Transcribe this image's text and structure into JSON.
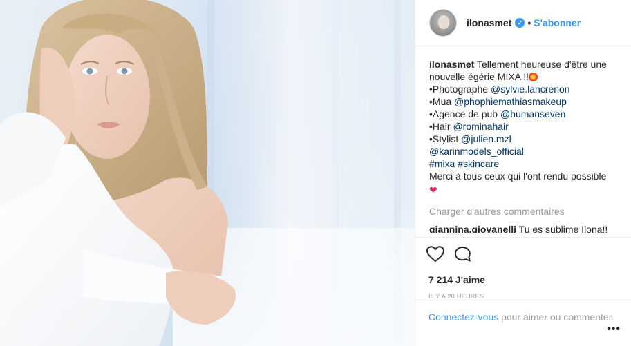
{
  "post": {
    "image_description": "photo",
    "username": "ilonasmet",
    "verified": true,
    "separator": "•",
    "follow_label": "S'abonner",
    "caption": {
      "username": "ilonasmet",
      "line1": "Tellement heureuse d'être une",
      "line2": "nouvelle égérie MIXA !!",
      "credit1_prefix": "•Photographe ",
      "credit1_mention": "@sylvie.lancrenon",
      "credit2_prefix": "•Mua ",
      "credit2_mention": "@phophiemathiasmakeup",
      "credit3_prefix": "•Agence de pub ",
      "credit3_mention": "@humanseven",
      "credit4_prefix": "•Hair ",
      "credit4_mention": "@rominahair",
      "credit5_prefix": "•Stylist ",
      "credit5_mention": "@julien.mzl",
      "agency_mention": "@karinmodels_official",
      "hashtag1": "#mixa",
      "hashtag2": "#skincare",
      "thanks": "Merci à tous ceux qui l'ont rendu possible"
    },
    "load_more_label": "Charger d'autres commentaires",
    "comments": [
      {
        "username": "giannina.giovanelli",
        "text": "Tu es sublime Ilona!!"
      }
    ],
    "likes_text": "7 214 J'aime",
    "time_text": "IL Y A 20 HEURES",
    "login_link": "Connectez-vous",
    "login_text": " pour aimer ou commenter."
  },
  "icons": {
    "like": "heart-outline-icon",
    "comment": "speech-bubble-icon",
    "more": "more-options-icon"
  },
  "colors": {
    "link_blue": "#3897f0",
    "mention_blue": "#003569",
    "muted_gray": "#999999",
    "text": "#262626"
  }
}
